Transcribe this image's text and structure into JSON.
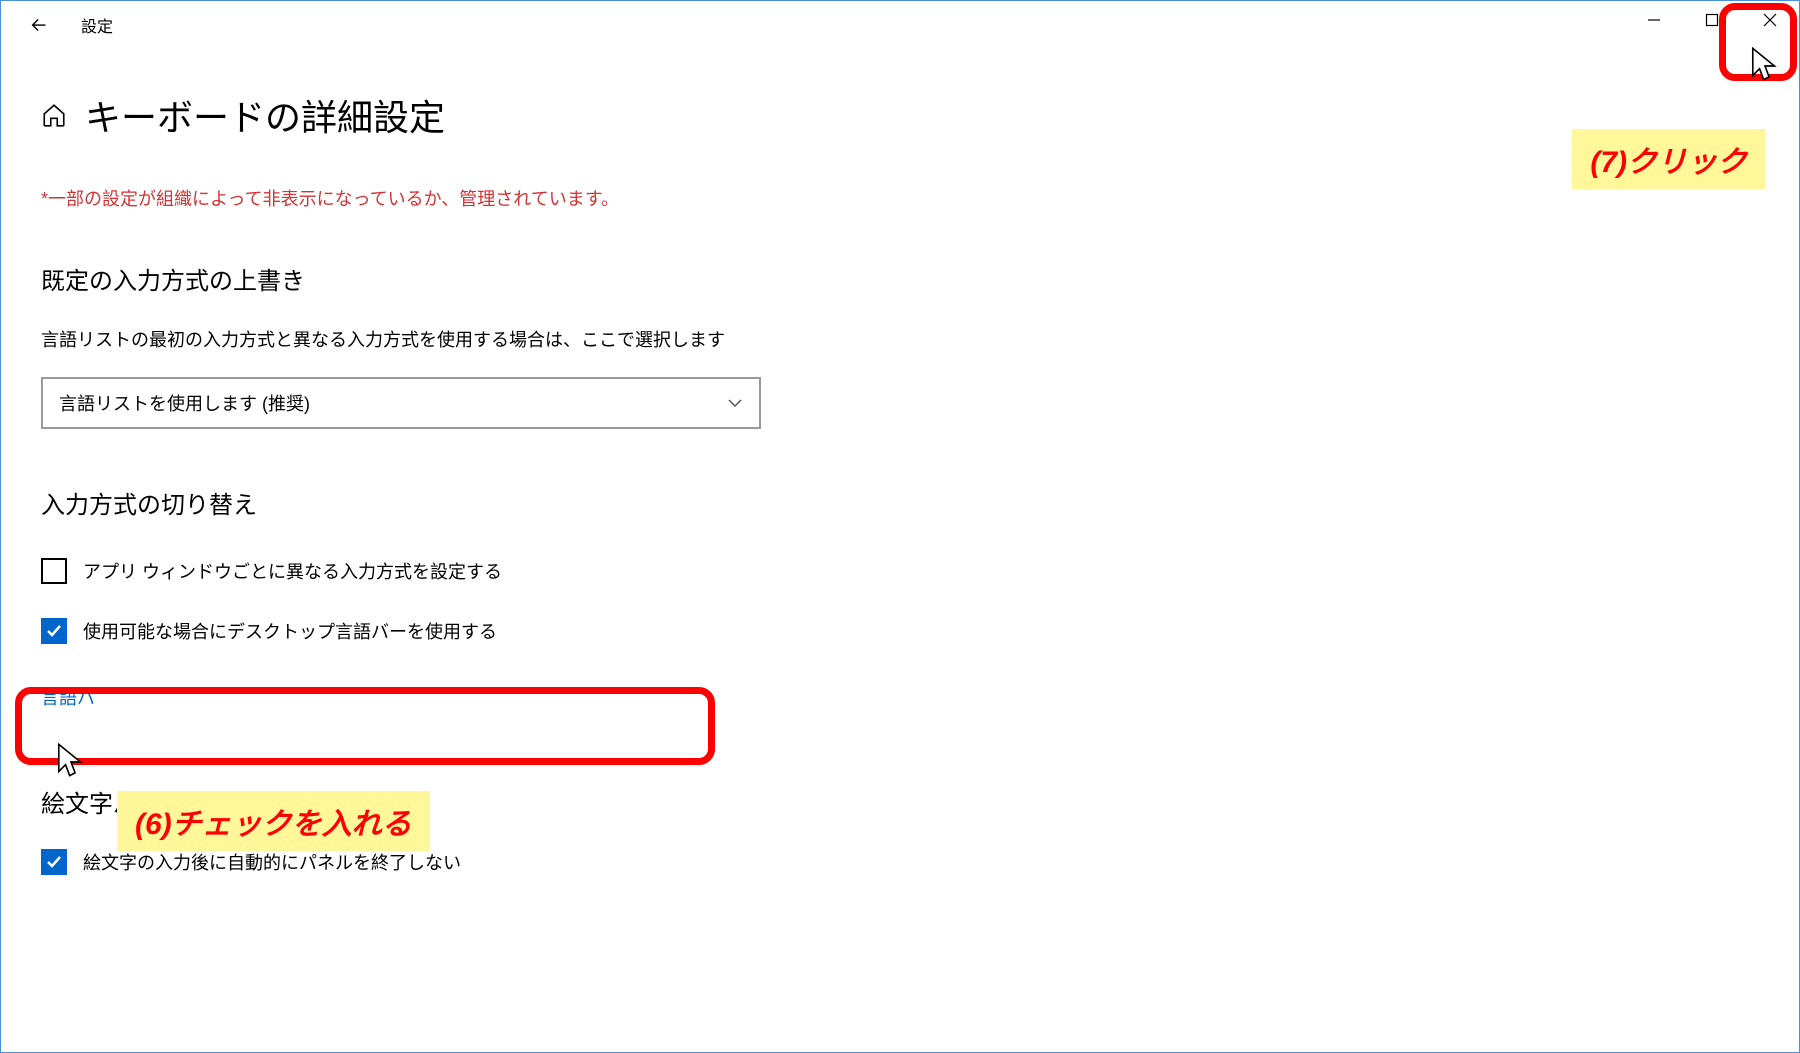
{
  "titlebar": {
    "app_name": "設定"
  },
  "page": {
    "title": "キーボードの詳細設定",
    "warning": "*一部の設定が組織によって非表示になっているか、管理されています。"
  },
  "override": {
    "heading": "既定の入力方式の上書き",
    "description": "言語リストの最初の入力方式と異なる入力方式を使用する場合は、ここで選択します",
    "dropdown_value": "言語リストを使用します (推奨)"
  },
  "switching": {
    "heading": "入力方式の切り替え",
    "checkbox1_label": "アプリ ウィンドウごとに異なる入力方式を設定する",
    "checkbox1_checked": false,
    "checkbox2_label": "使用可能な場合にデスクトップ言語バーを使用する",
    "checkbox2_checked": true,
    "link_label": "言語バ"
  },
  "emoji": {
    "heading": "絵文字パネル",
    "checkbox_label": "絵文字の入力後に自動的にパネルを終了しない",
    "checkbox_checked": true
  },
  "annotations": {
    "step6": "(6)チェックを入れる",
    "step7": "(7)クリック"
  }
}
